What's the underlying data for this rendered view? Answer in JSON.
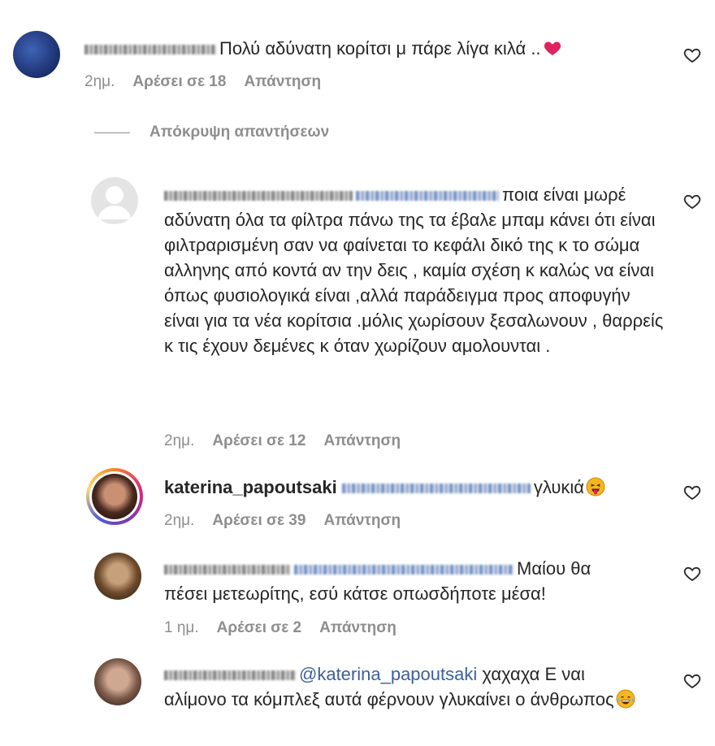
{
  "comments": [
    {
      "text": "Πολύ αδύνατη κορίτσι μ πάρε λίγα κιλά ..",
      "time": "2ημ.",
      "likes": "Αρέσει σε 18",
      "reply": "Απάντηση",
      "emoji": "red-heart"
    },
    {
      "text": "ποια είναι μωρέ αδύνατη όλα τα φίλτρα πάνω της τα έβαλε μπαμ κάνει ότι είναι φιλτραρισμένη σαν να φαίνεται το κεφάλι δικό της κ το σώμα αλληνης από κοντά αν την δεις , καμία σχέση κ καλώς να είναι όπως φυσιολογικά είναι ,αλλά παράδειγμα προς αποφυγήν είναι για τα νέα κορίτσια .μόλις χωρίσουν ξεσαλωνουν , θαρρείς κ τις έχουν δεμένες κ όταν χωρίζουν αμολουνται .",
      "time": "2ημ.",
      "likes": "Αρέσει σε 12",
      "reply": "Απάντηση"
    },
    {
      "username": "katerina_papoutsaki",
      "text": "γλυκιά",
      "time": "2ημ.",
      "likes": "Αρέσει σε 39",
      "reply": "Απάντηση",
      "emoji": "tongue-out-face"
    },
    {
      "text": "Μαίου θα πέσει μετεωρίτης, εσύ κάτσε οπωσδήποτε μέσα!",
      "time": "1 ημ.",
      "likes": "Αρέσει σε 2",
      "reply": "Απάντηση"
    },
    {
      "mention": "@katerina_papoutsaki",
      "text": "χαχαχα Ε ναι αλίμονο τα κόμπλεξ αυτά φέρνουν γλυκαίνει ο άνθρωπος",
      "emoji": "laughing-tears-face"
    }
  ],
  "hide_replies": "Απόκρυψη απαντήσεων",
  "colors": {
    "text": "#262626",
    "meta": "#8e8e8e",
    "mention": "#3d5f99",
    "heart": "#e0245e",
    "story_ring": "#d6249f"
  }
}
